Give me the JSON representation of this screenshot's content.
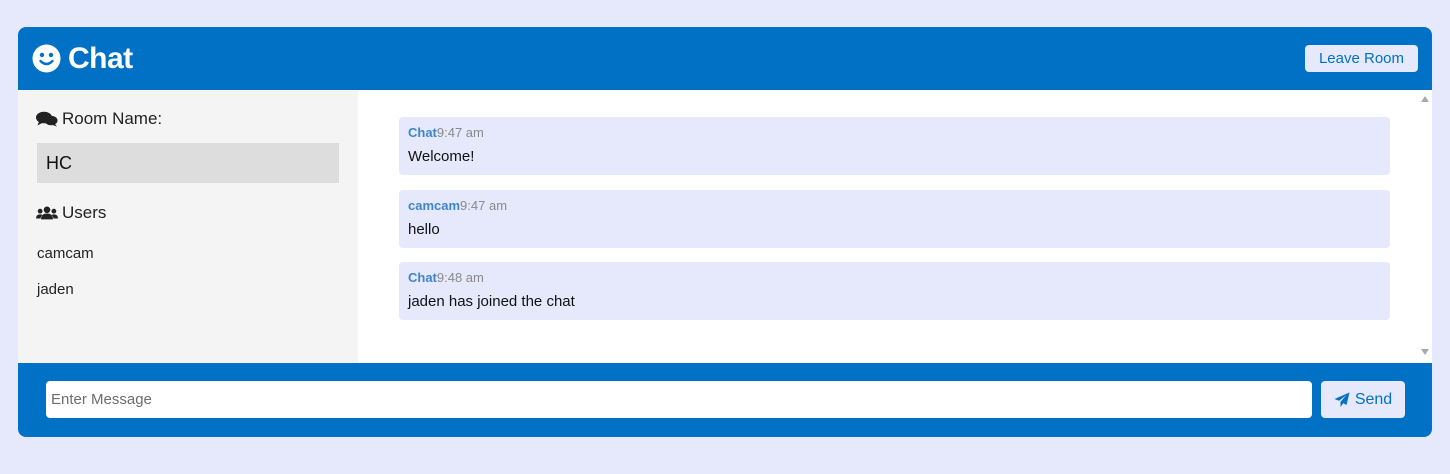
{
  "header": {
    "title": "Chat",
    "logo_icon": "smile-icon",
    "leave_label": "Leave Room",
    "color": "#0171c6"
  },
  "sidebar": {
    "room_label": "Room Name:",
    "room_icon": "comments-icon",
    "room_name": "HC",
    "users_label": "Users",
    "users_icon": "users-icon",
    "users": [
      "camcam",
      "jaden"
    ]
  },
  "messages": [
    {
      "user": "Chat",
      "time": "9:47 am",
      "text": "Welcome!"
    },
    {
      "user": "camcam",
      "time": "9:47 am",
      "text": "hello"
    },
    {
      "user": "Chat",
      "time": "9:48 am",
      "text": "jaden has joined the chat"
    }
  ],
  "form": {
    "placeholder": "Enter Message",
    "value": "",
    "send_label": "Send",
    "send_icon": "paper-plane-icon"
  },
  "colors": {
    "background": "#e6e8fb",
    "accent": "#0171c6",
    "sidebar": "#f4f4f4",
    "username": "#3f86c9"
  }
}
